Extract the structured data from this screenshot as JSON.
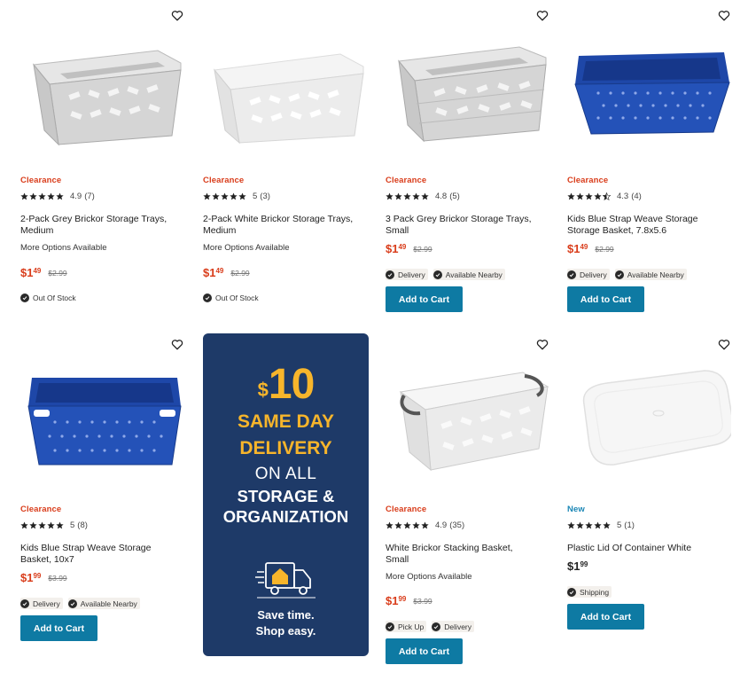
{
  "products": [
    {
      "id": "p1",
      "tag": "Clearance",
      "tag_type": "clear",
      "rating": "4.9",
      "reviews": "(7)",
      "title_line1": "2-Pack Grey Brickor Storage Trays,",
      "title_line2": "Medium",
      "more_options": "More Options Available",
      "price_dollars": "$1",
      "price_cents": "49",
      "price_was": "$2.99",
      "status": "Out Of Stock",
      "image_color": "#d9d9d9"
    },
    {
      "id": "p2",
      "tag": "Clearance",
      "tag_type": "clear",
      "rating": "5",
      "reviews": "(3)",
      "title_line1": "2-Pack White Brickor Storage Trays,",
      "title_line2": "Medium",
      "more_options": "More Options Available",
      "price_dollars": "$1",
      "price_cents": "49",
      "price_was": "$2.99",
      "status": "Out Of Stock",
      "image_color": "#f2f2f2"
    },
    {
      "id": "p3",
      "tag": "Clearance",
      "tag_type": "clear",
      "rating": "4.8",
      "reviews": "(5)",
      "title_line1": "3 Pack Grey Brickor Storage Trays,",
      "title_line2": "Small",
      "price_dollars": "$1",
      "price_cents": "49",
      "price_was": "$2.99",
      "chip1": "Delivery",
      "chip2": "Available Nearby",
      "button": "Add to Cart",
      "image_color": "#d9d9d9"
    },
    {
      "id": "p4",
      "tag": "Clearance",
      "tag_type": "clear",
      "rating": "4.3",
      "reviews": "(4)",
      "title_line1": "Kids Blue Strap Weave Storage",
      "title_line2": "Storage Basket, 7.8x5.6",
      "price_dollars": "$1",
      "price_cents": "49",
      "price_was": "$2.99",
      "chip1": "Delivery",
      "chip2": "Available Nearby",
      "button": "Add to Cart",
      "image_color": "#2452b8"
    },
    {
      "id": "p5",
      "tag": "Clearance",
      "tag_type": "clear",
      "rating": "5",
      "reviews": "(8)",
      "title_line1": "Kids Blue Strap Weave Storage",
      "title_line2": "Basket, 10x7",
      "price_dollars": "$1",
      "price_cents": "99",
      "price_was": "$3.99",
      "chip1": "Delivery",
      "chip2": "Available Nearby",
      "button": "Add to Cart",
      "image_color": "#2452b8"
    },
    {
      "id": "p6",
      "tag": "Clearance",
      "tag_type": "clear",
      "rating": "4.9",
      "reviews": "(35)",
      "title_line1": "White Brickor Stacking Basket,",
      "title_line2": "Small",
      "more_options": "More Options Available",
      "price_dollars": "$1",
      "price_cents": "99",
      "price_was": "$3.99",
      "chip1": "Pick Up",
      "chip2": "Delivery",
      "button": "Add to Cart",
      "image_color": "#f0f0f0"
    },
    {
      "id": "p7",
      "tag": "New",
      "tag_type": "new",
      "rating": "5",
      "reviews": "(1)",
      "title_line1": "Plastic Lid Of Container White",
      "title_line2": "",
      "price_dollars": "$1",
      "price_cents": "99",
      "chip1": "Shipping",
      "button": "Add to Cart",
      "image_color": "#f4f4f4"
    }
  ],
  "promo": {
    "amount_symbol": "$",
    "amount": "10",
    "line1": "SAME DAY",
    "line2": "DELIVERY",
    "line3": "ON ALL",
    "line4": "STORAGE &",
    "line5": "ORGANIZATION",
    "tagline1": "Save time.",
    "tagline2": "Shop easy.",
    "icon": "delivery-truck-icon",
    "bg_color": "#1e3a68",
    "accent_color": "#f7b52b"
  },
  "colors": {
    "clearance": "#d93c1a",
    "new": "#1a86b5",
    "button": "#0e7aa3"
  },
  "icons": {
    "wishlist": "heart-outline-icon",
    "star": "star-icon",
    "check": "check-circle-icon"
  }
}
